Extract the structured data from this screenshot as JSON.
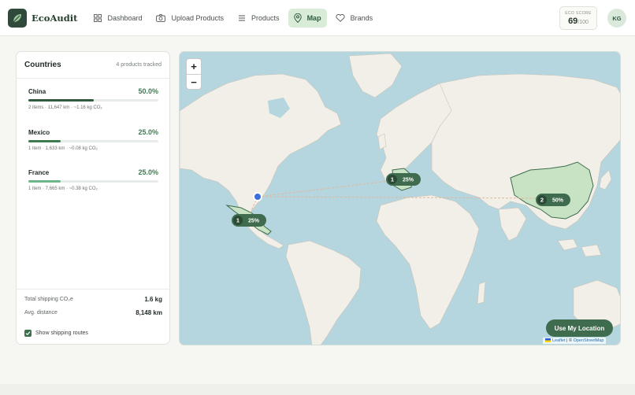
{
  "app": {
    "name": "EcoAudit"
  },
  "nav": {
    "items": [
      {
        "label": "Dashboard",
        "icon": "grid-icon",
        "active": false
      },
      {
        "label": "Upload Products",
        "icon": "camera-icon",
        "active": false
      },
      {
        "label": "Products",
        "icon": "list-icon",
        "active": false
      },
      {
        "label": "Map",
        "icon": "map-pin-icon",
        "active": true
      },
      {
        "label": "Brands",
        "icon": "heart-icon",
        "active": false
      }
    ]
  },
  "eco_score": {
    "label": "ECO SCORE",
    "value": "69",
    "max": "/100"
  },
  "user": {
    "initials": "KG"
  },
  "countries_panel": {
    "title": "Countries",
    "subtitle": "4 products tracked",
    "countries": [
      {
        "name": "China",
        "percent": "50.0%",
        "share": 0.5,
        "meta": "2 items · 11,647 km · ~1.16 kg CO₂",
        "bar_color": "#2f5a3e"
      },
      {
        "name": "Mexico",
        "percent": "25.0%",
        "share": 0.25,
        "meta": "1 item · 1,633 km · ~0.08 kg CO₂",
        "bar_color": "#3e7a50"
      },
      {
        "name": "France",
        "percent": "25.0%",
        "share": 0.25,
        "meta": "1 item · 7,665 km · ~0.38 kg CO₂",
        "bar_color": "#6fb58a"
      }
    ],
    "summary": [
      {
        "label": "Total shipping CO₂e",
        "value": "1.6 kg"
      },
      {
        "label": "Avg. distance",
        "value": "8,148 km"
      }
    ],
    "show_routes": {
      "label": "Show shipping routes",
      "checked": true
    }
  },
  "map": {
    "zoom_in": "+",
    "zoom_out": "−",
    "locate_button": "Use My Location",
    "attribution": {
      "leaflet": "Leaflet",
      "sep": " | © ",
      "osm": "OpenStreetMap"
    },
    "markers": [
      {
        "country": "France",
        "count": "1",
        "percent": "25%"
      },
      {
        "country": "China",
        "count": "2",
        "percent": "50%"
      },
      {
        "country": "Mexico",
        "count": "1",
        "percent": "25%"
      }
    ],
    "colors": {
      "ocean": "#b5d5df",
      "land": "#f1efe8",
      "highlight": "#c8e3c4",
      "highlight_stroke": "#3f6b4e",
      "route": "#e0b89a",
      "origin": "#3b6fe0"
    }
  }
}
